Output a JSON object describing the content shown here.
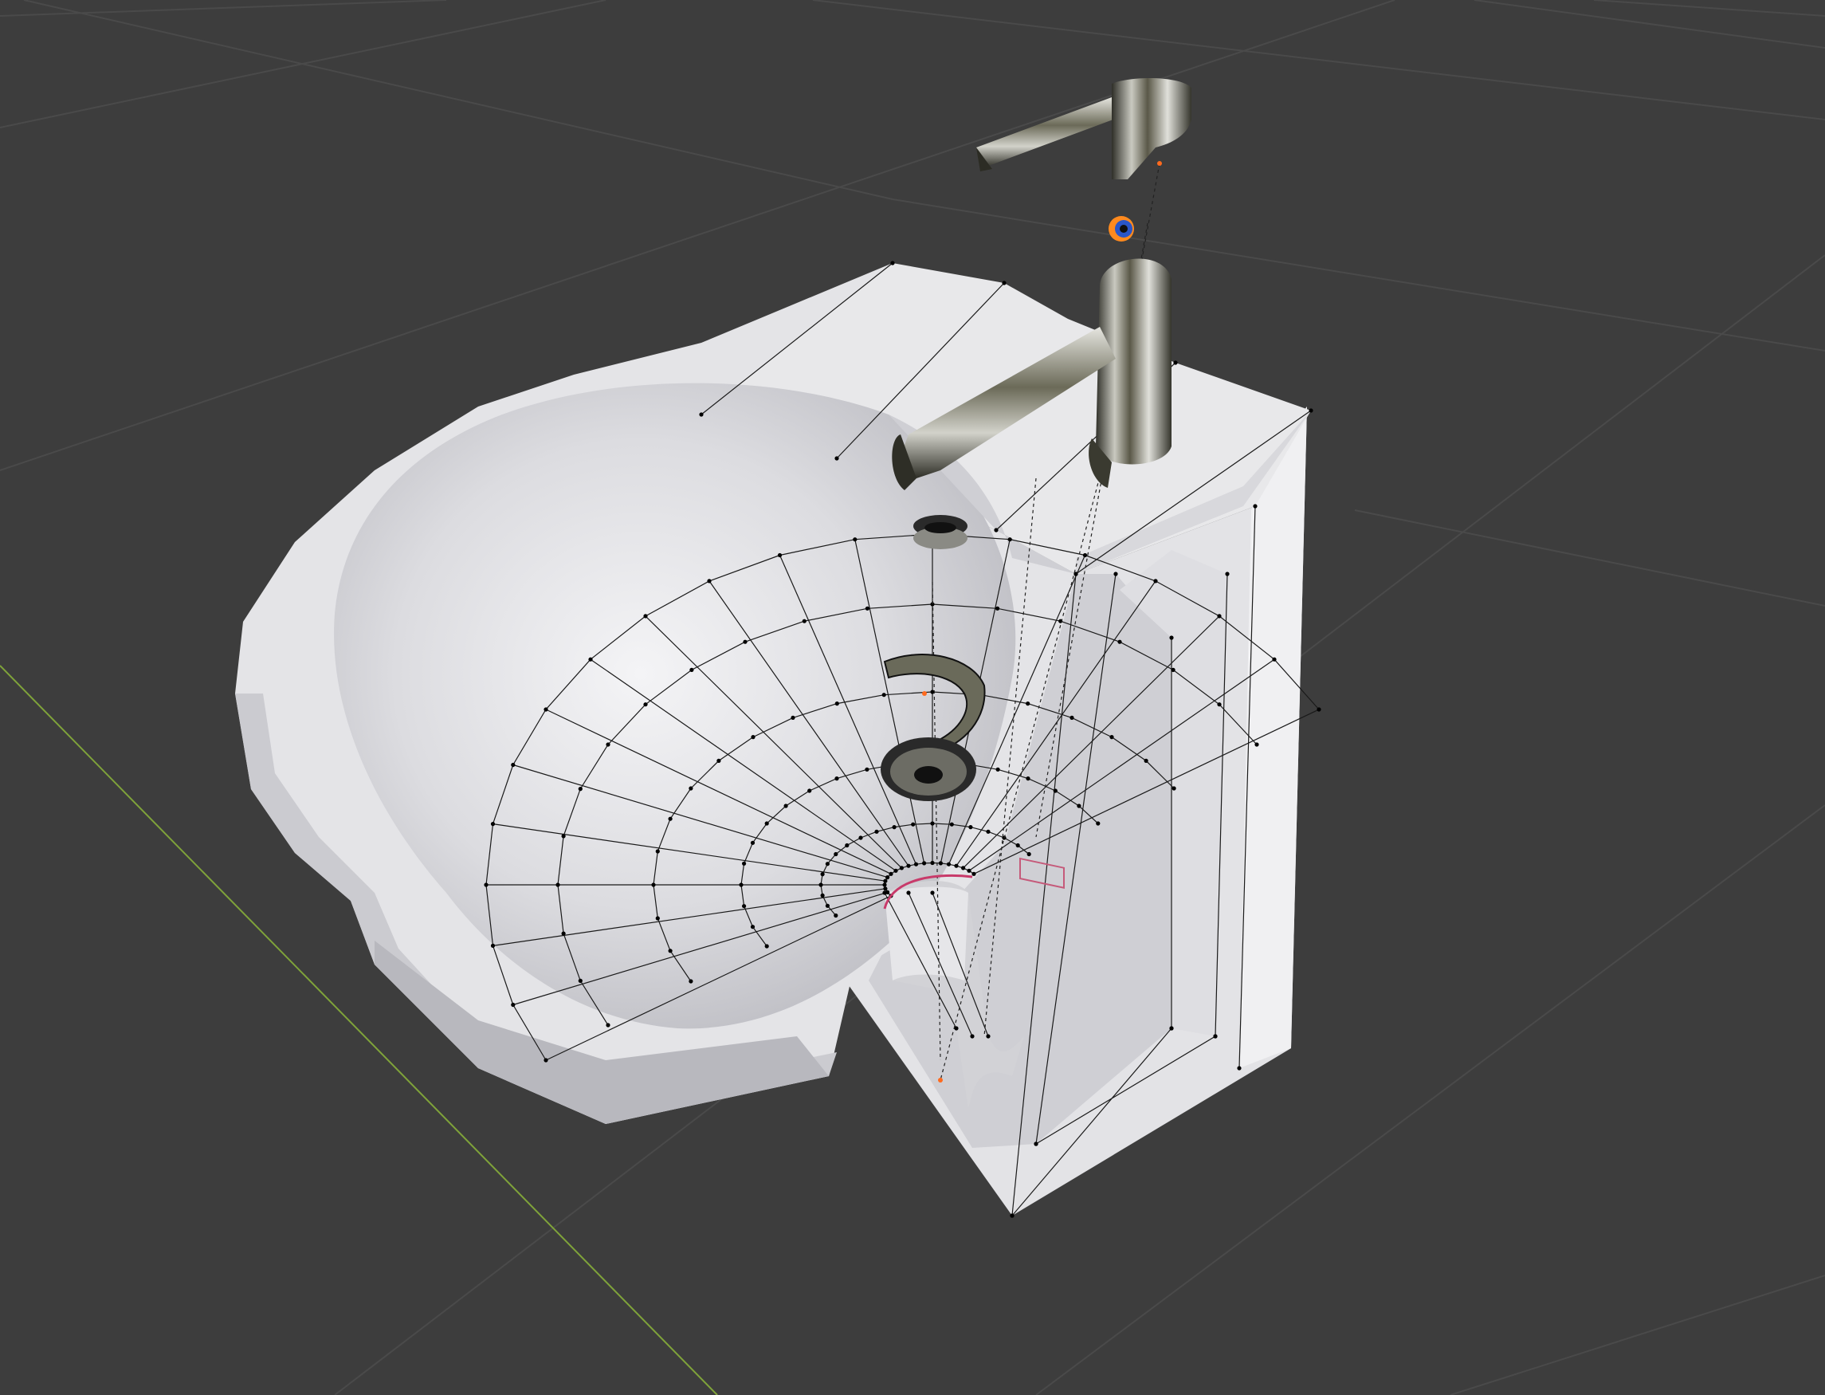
{
  "viewport": {
    "background": "#3d3d3d",
    "grid_color": "#4a4a4a",
    "x_axis_color": "#7fa33a",
    "mode": "edit-mode"
  },
  "scene": {
    "object": "wash-basin",
    "parts": [
      "basin-body",
      "pedestal",
      "faucet-spout",
      "faucet-body",
      "faucet-handle",
      "aerator",
      "drain-ring",
      "drain-strainer",
      "overflow-ring",
      "cartridge"
    ],
    "colors": {
      "ceramic": "#ececec",
      "ceramic_shade": "#c9c9cd",
      "ceramic_dark": "#a8a8ae",
      "wire": "#1a1a1a",
      "vertex": "#000000",
      "selected": "#ff8a1e",
      "chrome_light": "#e8e8e8",
      "chrome_dark": "#3a3a32"
    }
  }
}
